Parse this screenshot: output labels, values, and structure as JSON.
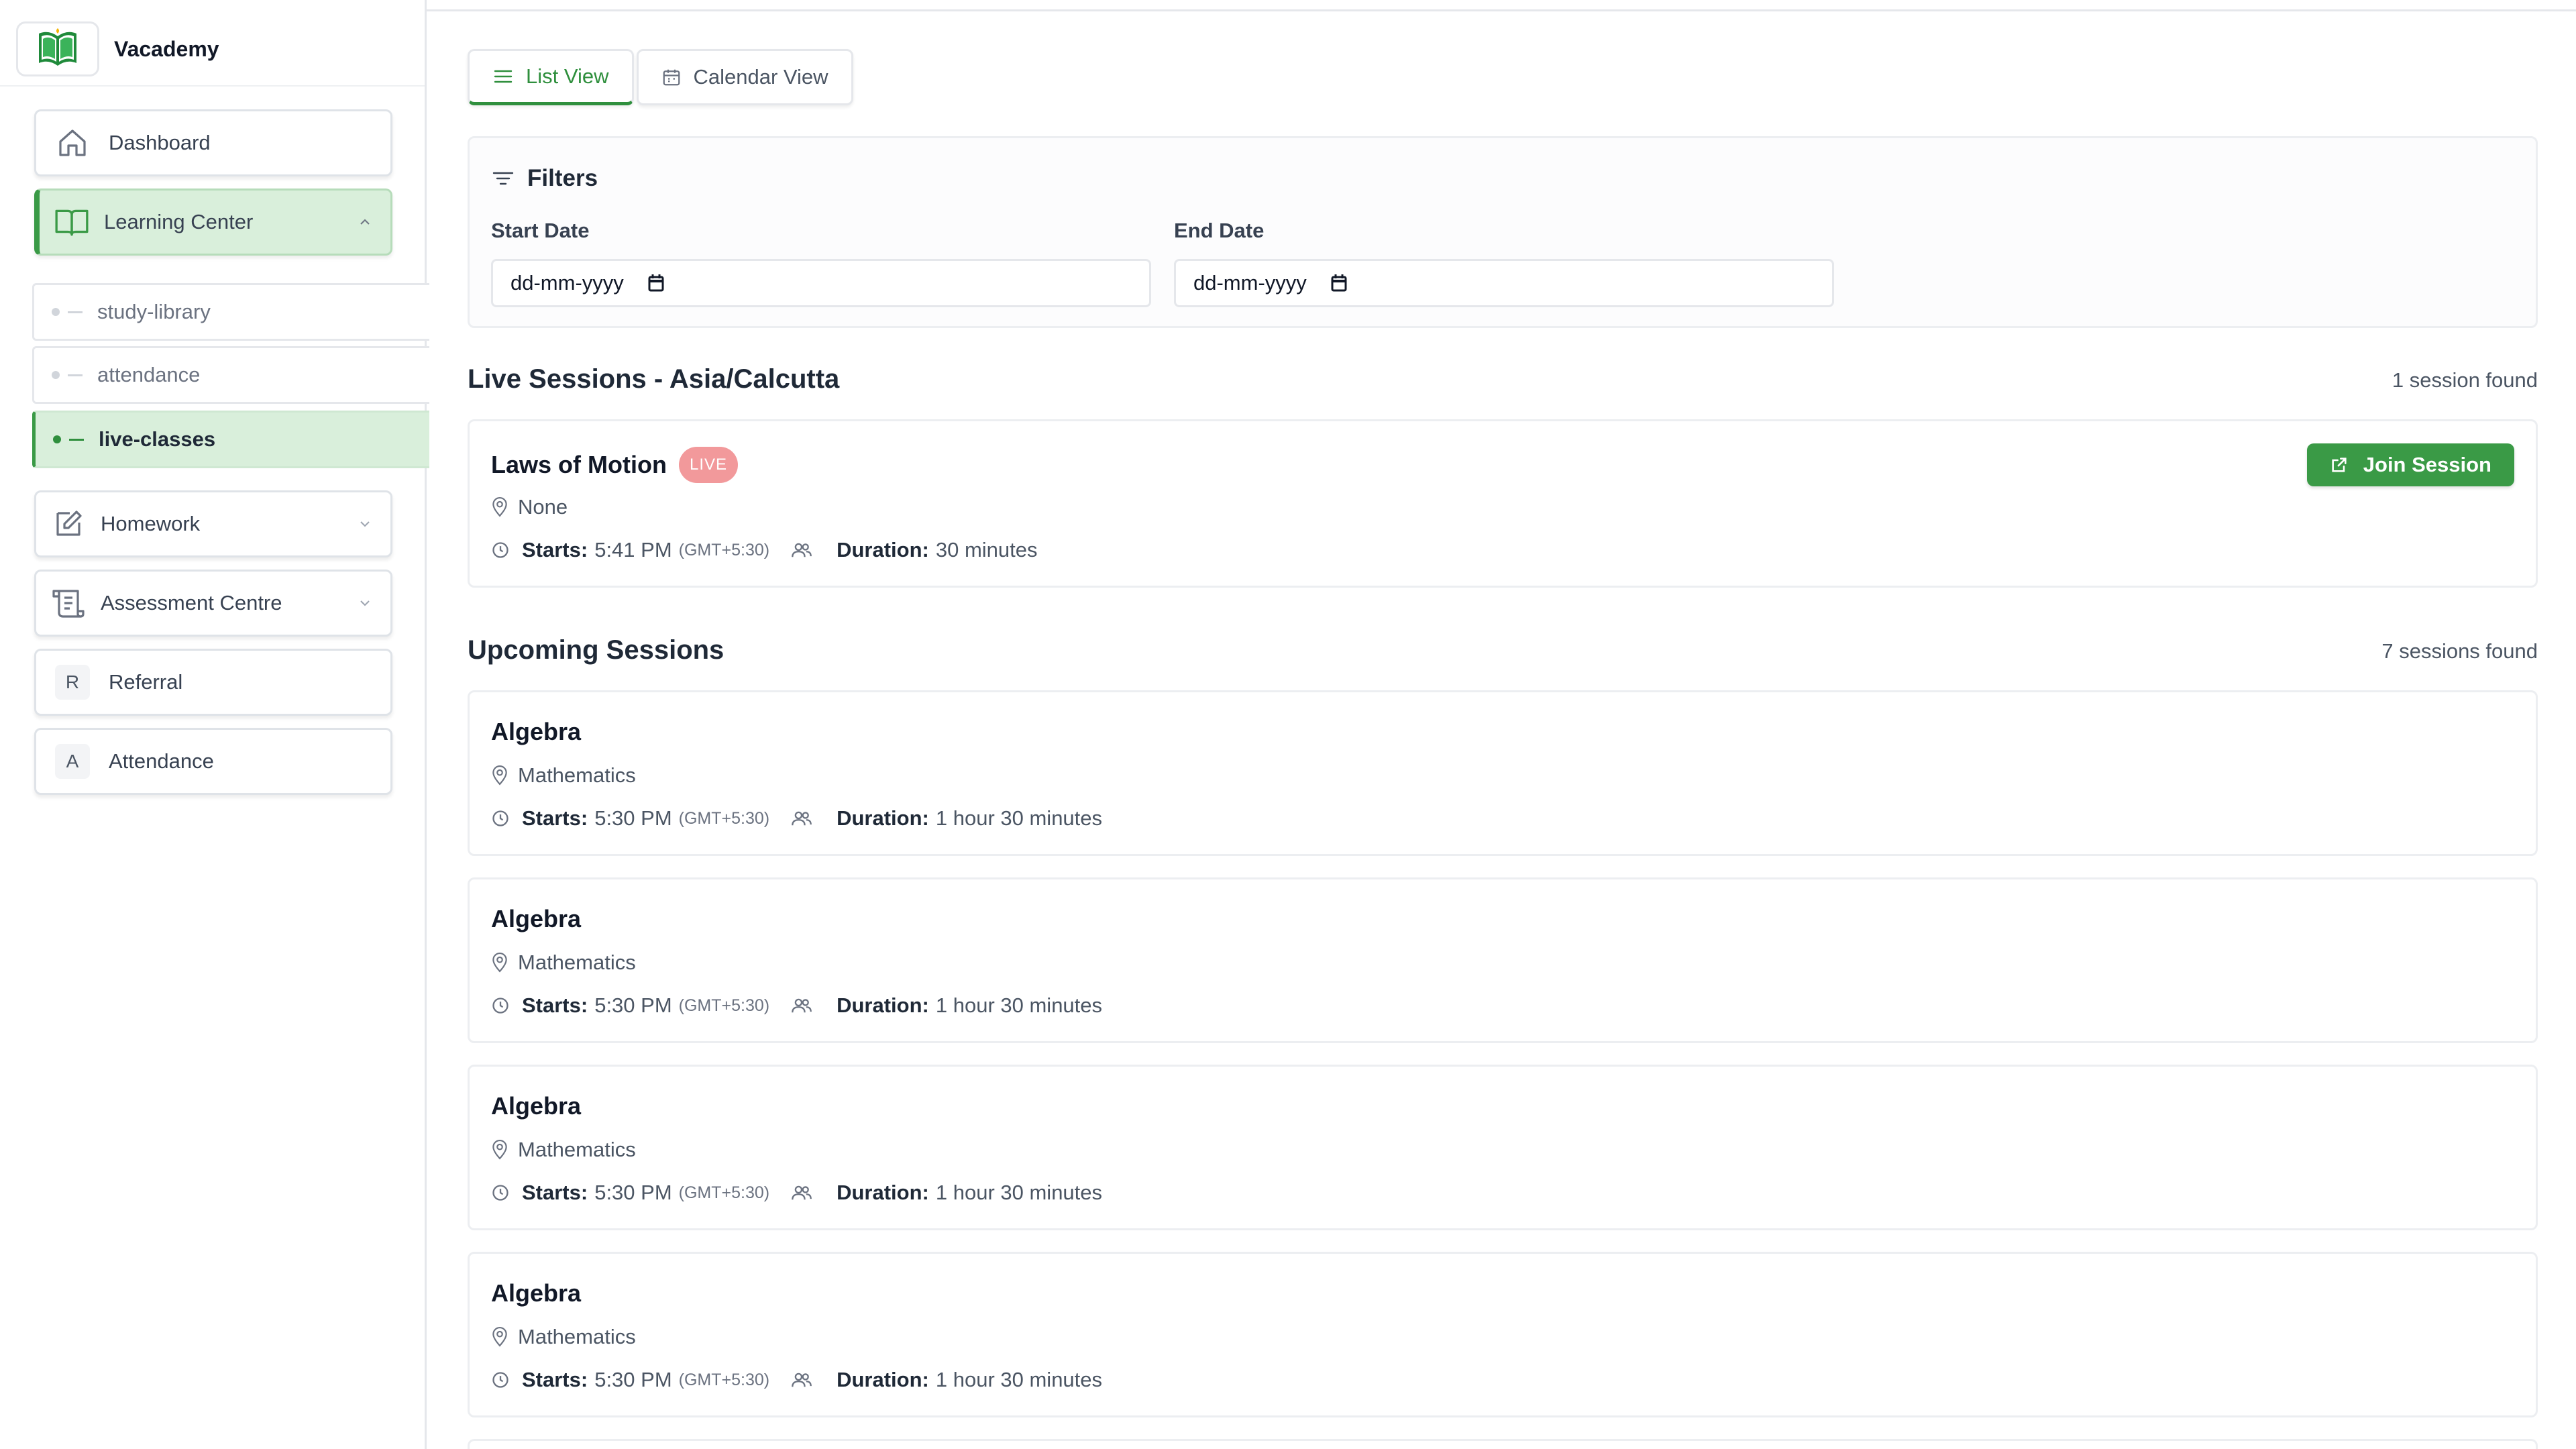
{
  "brand": {
    "name": "Vacademy",
    "logo_icon": "open-book-logo-icon"
  },
  "sidebar": {
    "items": [
      {
        "label": "Dashboard",
        "icon": "home-icon"
      },
      {
        "label": "Learning Center",
        "icon": "book-open-icon",
        "expanded": true
      },
      {
        "label": "Homework",
        "icon": "edit-icon"
      },
      {
        "label": "Assessment Centre",
        "icon": "scroll-icon"
      },
      {
        "label": "Referral",
        "badge": "R"
      },
      {
        "label": "Attendance",
        "badge": "A"
      }
    ],
    "sub_items": [
      {
        "label": "study-library"
      },
      {
        "label": "attendance"
      },
      {
        "label": "live-classes",
        "active": true
      }
    ]
  },
  "view_toggle": {
    "list_label": "List View",
    "calendar_label": "Calendar View",
    "active": "list"
  },
  "filters": {
    "title": "Filters",
    "start_label": "Start Date",
    "start_value": "dd-mm-yyyy",
    "end_label": "End Date",
    "end_value": "dd-mm-yyyy"
  },
  "live": {
    "title": "Live Sessions - Asia/Calcutta",
    "count": "1 session found",
    "sessions": [
      {
        "title": "Laws of Motion",
        "badge": "LIVE",
        "location": "None",
        "starts_label": "Starts:",
        "starts": "5:41 PM",
        "tz": "(GMT+5:30)",
        "duration_label": "Duration:",
        "duration": "30 minutes",
        "join_label": "Join Session"
      }
    ]
  },
  "upcoming": {
    "title": "Upcoming Sessions",
    "count": "7 sessions found",
    "sessions": [
      {
        "title": "Algebra",
        "location": "Mathematics",
        "starts_label": "Starts:",
        "starts": "5:30 PM",
        "tz": "(GMT+5:30)",
        "duration_label": "Duration:",
        "duration": "1 hour 30 minutes"
      },
      {
        "title": "Algebra",
        "location": "Mathematics",
        "starts_label": "Starts:",
        "starts": "5:30 PM",
        "tz": "(GMT+5:30)",
        "duration_label": "Duration:",
        "duration": "1 hour 30 minutes"
      },
      {
        "title": "Algebra",
        "location": "Mathematics",
        "starts_label": "Starts:",
        "starts": "5:30 PM",
        "tz": "(GMT+5:30)",
        "duration_label": "Duration:",
        "duration": "1 hour 30 minutes"
      },
      {
        "title": "Algebra",
        "location": "Mathematics",
        "starts_label": "Starts:",
        "starts": "5:30 PM",
        "tz": "(GMT+5:30)",
        "duration_label": "Duration:",
        "duration": "1 hour 30 minutes"
      }
    ]
  },
  "colors": {
    "accent": "#2f8f3d",
    "accent_light": "#d9efdb",
    "live_badge": "#f2999b"
  }
}
